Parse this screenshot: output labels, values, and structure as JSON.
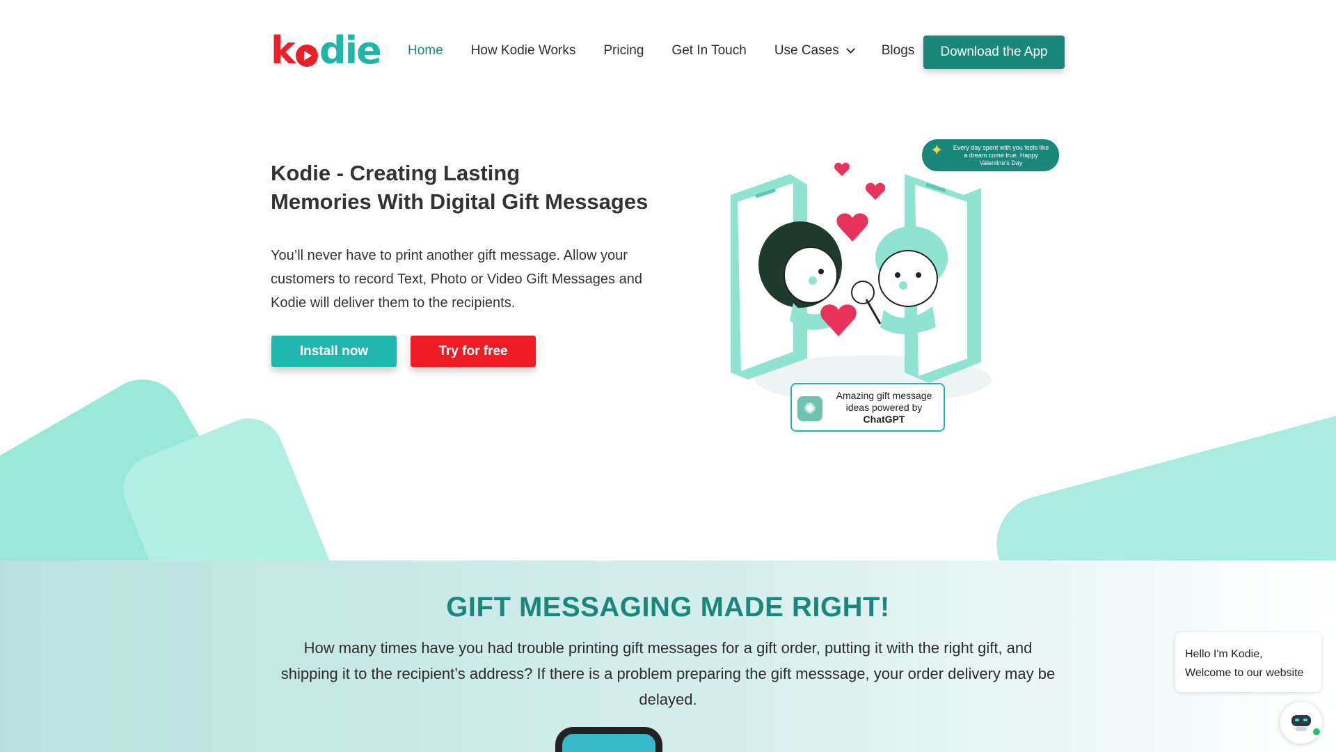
{
  "brand": {
    "logo_k": "k",
    "logo_rest": "die"
  },
  "nav": {
    "items": [
      {
        "label": "Home"
      },
      {
        "label": "How Kodie Works"
      },
      {
        "label": "Pricing"
      },
      {
        "label": "Get In Touch"
      },
      {
        "label": "Use Cases"
      },
      {
        "label": "Blogs"
      }
    ],
    "cta": "Download the App"
  },
  "hero": {
    "title_line1": "Kodie - Creating Lasting",
    "title_line2": "Memories With Digital Gift Messages",
    "description": "You’ll never have to print another gift message. Allow your customers to record Text, Photo or Video Gift Messages and Kodie will deliver them to the recipients.",
    "install_label": "Install now",
    "try_label": "Try for free"
  },
  "illustration": {
    "bubble_text": "Every day spent with you feels like a dream come true. Happy Valentine's Day",
    "gpt_text": "Amazing gift message ideas powered by",
    "gpt_strong": "ChatGPT"
  },
  "section": {
    "title": "GIFT MESSAGING MADE RIGHT!",
    "description": "How many times have you had trouble printing gift messages for a gift order, putting it with the right gift, and shipping it to the recipient’s address? If there is a problem preparing the gift messsage, your order delivery may be delayed."
  },
  "chat": {
    "line1": "Hello I'm Kodie,",
    "line2": "Welcome to our website"
  },
  "colors": {
    "brand_red": "#e8202a",
    "brand_teal": "#1fb5a8",
    "cta_dark_teal": "#1a877b",
    "install_teal": "#20b8ae",
    "try_red": "#ee1c25"
  }
}
